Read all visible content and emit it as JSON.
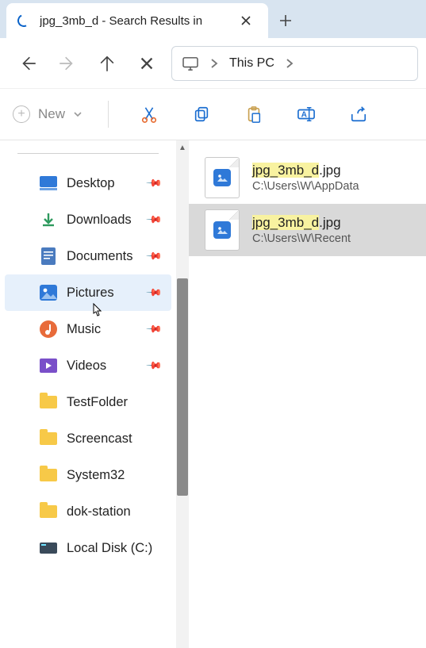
{
  "tab": {
    "title": "jpg_3mb_d - Search Results in"
  },
  "nav": {
    "breadcrumb": [
      "This PC"
    ]
  },
  "toolbar": {
    "new_label": "New"
  },
  "sidebar": {
    "items": [
      {
        "label": "Desktop",
        "icon": "desktop",
        "pinned": true
      },
      {
        "label": "Downloads",
        "icon": "download",
        "pinned": true
      },
      {
        "label": "Documents",
        "icon": "document",
        "pinned": true
      },
      {
        "label": "Pictures",
        "icon": "pictures",
        "pinned": true,
        "hover": true
      },
      {
        "label": "Music",
        "icon": "music",
        "pinned": true
      },
      {
        "label": "Videos",
        "icon": "videos",
        "pinned": true
      },
      {
        "label": "TestFolder",
        "icon": "folder",
        "pinned": false
      },
      {
        "label": "Screencast",
        "icon": "folder",
        "pinned": false
      },
      {
        "label": "System32",
        "icon": "folder",
        "pinned": false
      },
      {
        "label": "dok-station",
        "icon": "folder",
        "pinned": false
      },
      {
        "label": "Local Disk (C:)",
        "icon": "disk",
        "pinned": false
      }
    ]
  },
  "results": [
    {
      "name_hl": "jpg_3mb_d",
      "name_ext": ".jpg",
      "path": "C:\\Users\\W\\AppData",
      "selected": false
    },
    {
      "name_hl": "jpg_3mb_d",
      "name_ext": ".jpg",
      "path": "C:\\Users\\W\\Recent",
      "selected": true
    }
  ]
}
